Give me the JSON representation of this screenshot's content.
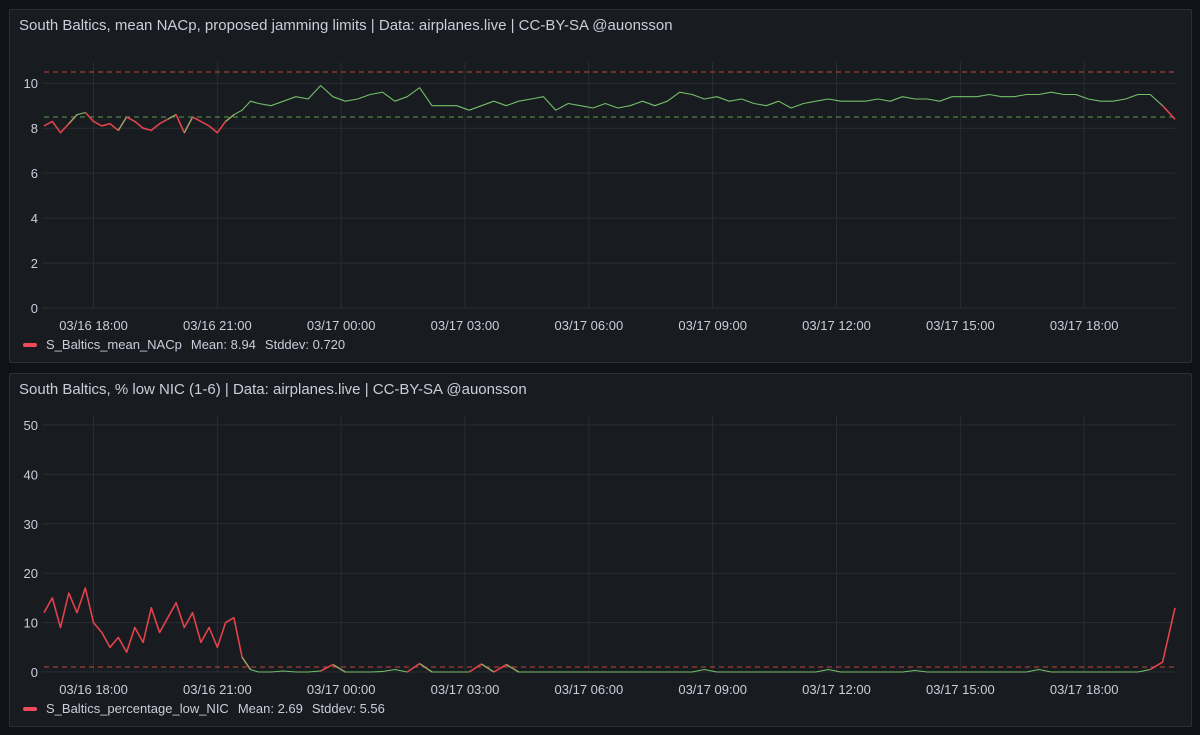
{
  "panels": [
    {
      "title": "South Baltics, mean NACp, proposed jamming limits | Data: airplanes.live | CC-BY-SA @auonsson",
      "legend": {
        "name": "S_Baltics_mean_NACp",
        "mean": "Mean: 8.94",
        "stddev": "Stddev: 0.720"
      }
    },
    {
      "title": "South Baltics, % low NIC (1-6) | Data: airplanes.live | CC-BY-SA @auonsson",
      "legend": {
        "name": "S_Baltics_percentage_low_NIC",
        "mean": "Mean: 2.69",
        "stddev": "Stddev: 5.56"
      }
    }
  ],
  "colors": {
    "green": "#73bf69",
    "red": "#f2495c",
    "red_line": "#e0434b",
    "grid": "#2a2d33",
    "threshold_red": "#c4453b",
    "threshold_green": "#5a9e52"
  },
  "chart_data": [
    {
      "type": "line",
      "x_unit": "hours since 03/16 18:00",
      "x_ticks": [
        "03/16 18:00",
        "03/16 21:00",
        "03/17 00:00",
        "03/17 03:00",
        "03/17 06:00",
        "03/17 09:00",
        "03/17 12:00",
        "03/17 15:00",
        "03/17 18:00"
      ],
      "xlim": [
        -1.2,
        26.2
      ],
      "ylim": [
        0,
        10.5
      ],
      "y_ticks": [
        0,
        2,
        4,
        6,
        8,
        10
      ],
      "thresholds": [
        {
          "value": 10.5,
          "color": "red"
        },
        {
          "value": 8.5,
          "color": "green"
        }
      ],
      "color_threshold": 8.5,
      "series": [
        {
          "name": "S_Baltics_mean_NACp",
          "x": [
            -1.2,
            -1.0,
            -0.8,
            -0.6,
            -0.4,
            -0.2,
            0.0,
            0.2,
            0.4,
            0.6,
            0.8,
            1.0,
            1.2,
            1.4,
            1.6,
            1.8,
            2.0,
            2.2,
            2.4,
            2.6,
            2.8,
            3.0,
            3.2,
            3.4,
            3.6,
            3.8,
            4.0,
            4.3,
            4.6,
            4.9,
            5.2,
            5.5,
            5.8,
            6.1,
            6.4,
            6.7,
            7.0,
            7.3,
            7.6,
            7.9,
            8.2,
            8.5,
            8.8,
            9.1,
            9.4,
            9.7,
            10.0,
            10.3,
            10.6,
            10.9,
            11.2,
            11.5,
            11.8,
            12.1,
            12.4,
            12.7,
            13.0,
            13.3,
            13.6,
            13.9,
            14.2,
            14.5,
            14.8,
            15.1,
            15.4,
            15.7,
            16.0,
            16.3,
            16.6,
            16.9,
            17.2,
            17.5,
            17.8,
            18.1,
            18.4,
            18.7,
            19.0,
            19.3,
            19.6,
            19.9,
            20.2,
            20.5,
            20.8,
            21.1,
            21.4,
            21.7,
            22.0,
            22.3,
            22.6,
            22.9,
            23.2,
            23.5,
            23.8,
            24.1,
            24.4,
            24.7,
            25.0,
            25.3,
            25.6,
            25.9,
            26.2
          ],
          "y": [
            8.1,
            8.3,
            7.8,
            8.2,
            8.6,
            8.7,
            8.3,
            8.1,
            8.2,
            7.9,
            8.5,
            8.3,
            8.0,
            7.9,
            8.2,
            8.4,
            8.6,
            7.8,
            8.5,
            8.3,
            8.1,
            7.8,
            8.3,
            8.6,
            8.8,
            9.2,
            9.1,
            9.0,
            9.2,
            9.4,
            9.3,
            9.9,
            9.4,
            9.2,
            9.3,
            9.5,
            9.6,
            9.2,
            9.4,
            9.8,
            9.0,
            9.0,
            9.0,
            8.8,
            9.0,
            9.2,
            9.0,
            9.2,
            9.3,
            9.4,
            8.8,
            9.1,
            9.0,
            8.9,
            9.1,
            8.9,
            9.0,
            9.2,
            9.0,
            9.2,
            9.6,
            9.5,
            9.3,
            9.4,
            9.2,
            9.3,
            9.1,
            9.0,
            9.2,
            8.9,
            9.1,
            9.2,
            9.3,
            9.2,
            9.2,
            9.2,
            9.3,
            9.2,
            9.4,
            9.3,
            9.3,
            9.2,
            9.4,
            9.4,
            9.4,
            9.5,
            9.4,
            9.4,
            9.5,
            9.5,
            9.6,
            9.5,
            9.5,
            9.3,
            9.2,
            9.2,
            9.3,
            9.5,
            9.5,
            9.0,
            8.4
          ]
        }
      ]
    },
    {
      "type": "line",
      "x_unit": "hours since 03/16 18:00",
      "x_ticks": [
        "03/16 18:00",
        "03/16 21:00",
        "03/17 00:00",
        "03/17 03:00",
        "03/17 06:00",
        "03/17 09:00",
        "03/17 12:00",
        "03/17 15:00",
        "03/17 18:00"
      ],
      "xlim": [
        -1.2,
        26.2
      ],
      "ylim": [
        0,
        50
      ],
      "y_ticks": [
        0,
        10,
        20,
        30,
        40,
        50
      ],
      "thresholds": [
        {
          "value": 1,
          "color": "red"
        }
      ],
      "color_threshold": 1,
      "series": [
        {
          "name": "S_Baltics_percentage_low_NIC",
          "x": [
            -1.2,
            -1.0,
            -0.8,
            -0.6,
            -0.4,
            -0.2,
            0.0,
            0.2,
            0.4,
            0.6,
            0.8,
            1.0,
            1.2,
            1.4,
            1.6,
            1.8,
            2.0,
            2.2,
            2.4,
            2.6,
            2.8,
            3.0,
            3.2,
            3.4,
            3.6,
            3.8,
            4.0,
            4.3,
            4.6,
            4.9,
            5.2,
            5.5,
            5.8,
            6.1,
            6.4,
            6.7,
            7.0,
            7.3,
            7.6,
            7.9,
            8.2,
            8.5,
            8.8,
            9.1,
            9.4,
            9.7,
            10.0,
            10.3,
            10.6,
            10.9,
            11.2,
            11.5,
            11.8,
            12.1,
            12.4,
            12.7,
            13.0,
            13.3,
            13.6,
            13.9,
            14.2,
            14.5,
            14.8,
            15.1,
            15.4,
            15.7,
            16.0,
            16.3,
            16.6,
            16.9,
            17.2,
            17.5,
            17.8,
            18.1,
            18.4,
            18.7,
            19.0,
            19.3,
            19.6,
            19.9,
            20.2,
            20.5,
            20.8,
            21.1,
            21.4,
            21.7,
            22.0,
            22.3,
            22.6,
            22.9,
            23.2,
            23.5,
            23.8,
            24.1,
            24.4,
            24.7,
            25.0,
            25.3,
            25.6,
            25.9,
            26.2
          ],
          "y": [
            12,
            15,
            9,
            16,
            12,
            17,
            10,
            8,
            5,
            7,
            4,
            9,
            6,
            13,
            8,
            11,
            14,
            9,
            12,
            6,
            9,
            5,
            10,
            11,
            3,
            0.5,
            0,
            0,
            0.2,
            0,
            0,
            0.2,
            1.5,
            0,
            0,
            0,
            0.1,
            0.5,
            0,
            1.7,
            0,
            0,
            0,
            0,
            1.6,
            0,
            1.5,
            0,
            0,
            0,
            0,
            0,
            0,
            0,
            0,
            0,
            0,
            0,
            0,
            0,
            0,
            0,
            0.5,
            0,
            0,
            0,
            0,
            0,
            0,
            0,
            0,
            0,
            0.5,
            0,
            0,
            0,
            0,
            0,
            0,
            0.3,
            0,
            0,
            0,
            0,
            0,
            0,
            0,
            0,
            0,
            0.5,
            0,
            0,
            0,
            0,
            0,
            0,
            0,
            0,
            0.5,
            2,
            13
          ]
        }
      ]
    }
  ]
}
